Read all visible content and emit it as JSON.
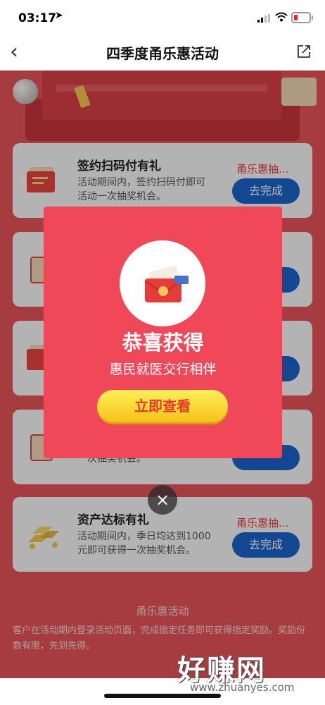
{
  "status": {
    "time": "03:17",
    "location_glyph": "➤"
  },
  "nav": {
    "back_glyph": "‹",
    "title": "四季度甬乐惠活动"
  },
  "tasks": [
    {
      "name": "签约扫码付有礼",
      "desc": "活动期间内，签约扫码付即可活动一次抽奖机会。",
      "tag": "甬乐惠抽...",
      "button": "去完成"
    },
    {
      "name": "",
      "desc": "",
      "tag": "",
      "button": ""
    },
    {
      "name": "",
      "desc": "",
      "tag": "",
      "button": ""
    },
    {
      "name": "",
      "desc": "一次抽奖机会。",
      "tag": "",
      "button": ""
    },
    {
      "name": "资产达标有礼",
      "desc": "活动期间内，季日均达到1000元即可获得一次抽奖机会。",
      "tag": "甬乐惠抽...",
      "button": "去完成"
    }
  ],
  "footer": {
    "title": "甬乐惠活动",
    "text": "客户在活动期内登录活动页面，完成指定任务即可获得指定奖励。奖励份数有限，先到先得。"
  },
  "modal": {
    "title": "恭喜获得",
    "subtitle": "惠民就医交行相伴",
    "button": "立即查看",
    "close_glyph": "×"
  },
  "watermark": {
    "main": "好赚网",
    "url": "www.zhuanyes.com"
  },
  "colors": {
    "page_bg": "#e85459",
    "modal_bg": "#f04858",
    "task_button": "#1b63c9",
    "tag_red": "#e64047"
  }
}
